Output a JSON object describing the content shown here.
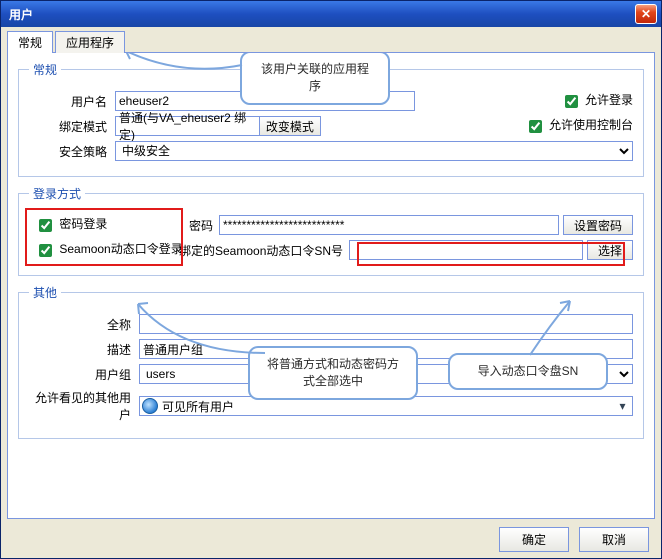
{
  "window": {
    "title": "用户"
  },
  "tabs": {
    "general": "常规",
    "apps": "应用程序"
  },
  "callouts": {
    "top": "该用户关联的应用程序",
    "mid": "将普通方式和动态密码方式全部选中",
    "right": "导入动态口令盘SN"
  },
  "general": {
    "legend": "常规",
    "username_label": "用户名",
    "username_value": "eheuser2",
    "allow_login": "允许登录",
    "bind_label": "绑定模式",
    "bind_value": "普通(与VA_eheuser2 绑定)",
    "change_mode_btn": "改变模式",
    "allow_console": "允许使用控制台",
    "policy_label": "安全策略",
    "policy_value": "中级安全"
  },
  "login": {
    "legend": "登录方式",
    "pwd_login": "密码登录",
    "seamoon": "Seamoon动态口令登录",
    "pwd_label": "密码",
    "pwd_value": "**************************",
    "set_pwd_btn": "设置密码",
    "sn_label": "绑定的Seamoon动态口令SN号",
    "sn_value": "",
    "choose_btn": "选择"
  },
  "other": {
    "legend": "其他",
    "fullname_label": "全称",
    "fullname_value": "",
    "desc_label": "描述",
    "desc_value": "普通用户组",
    "group_label": "用户组",
    "group_value": "users",
    "visible_label": "允许看见的其他用户",
    "visible_value": "可见所有用户"
  },
  "footer": {
    "ok": "确定",
    "cancel": "取消"
  }
}
